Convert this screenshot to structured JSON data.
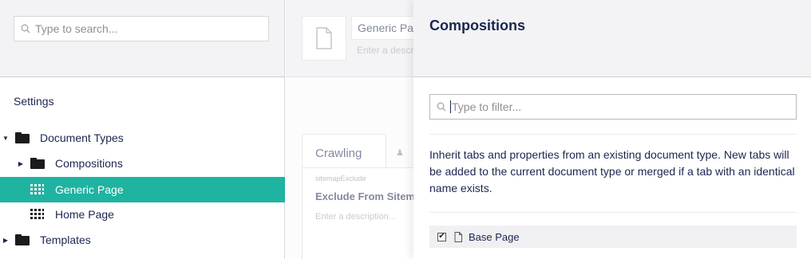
{
  "left": {
    "search_placeholder": "Type to search...",
    "section_title": "Settings",
    "tree": [
      {
        "label": "Document Types",
        "expanded": true,
        "icon": "folder-icon"
      },
      {
        "label": "Compositions",
        "expanded": false,
        "icon": "folder-icon"
      },
      {
        "label": "Generic Page",
        "active": true,
        "icon": "doc-type-grid-icon"
      },
      {
        "label": "Home Page",
        "icon": "doc-type-grid-icon"
      },
      {
        "label": "Templates",
        "expanded": false,
        "icon": "folder-icon"
      }
    ]
  },
  "editor": {
    "name_value": "Generic Page",
    "description_placeholder": "Enter a description...",
    "tab_label": "Crawling",
    "property_alias": "sitemapExclude",
    "property_name": "Exclude From Sitemap",
    "property_description_placeholder": "Enter a description..."
  },
  "compositions": {
    "title": "Compositions",
    "filter_placeholder": "Type to filter...",
    "info": "Inherit tabs and properties from an existing document type. New tabs will be added to the current document type or merged if a tab with an identical name exists.",
    "items": [
      {
        "label": "Base Page",
        "checked": true
      }
    ]
  },
  "colors": {
    "accent": "#1fb3a2",
    "text": "#1b264f",
    "header_bg": "#f3f3f5"
  }
}
